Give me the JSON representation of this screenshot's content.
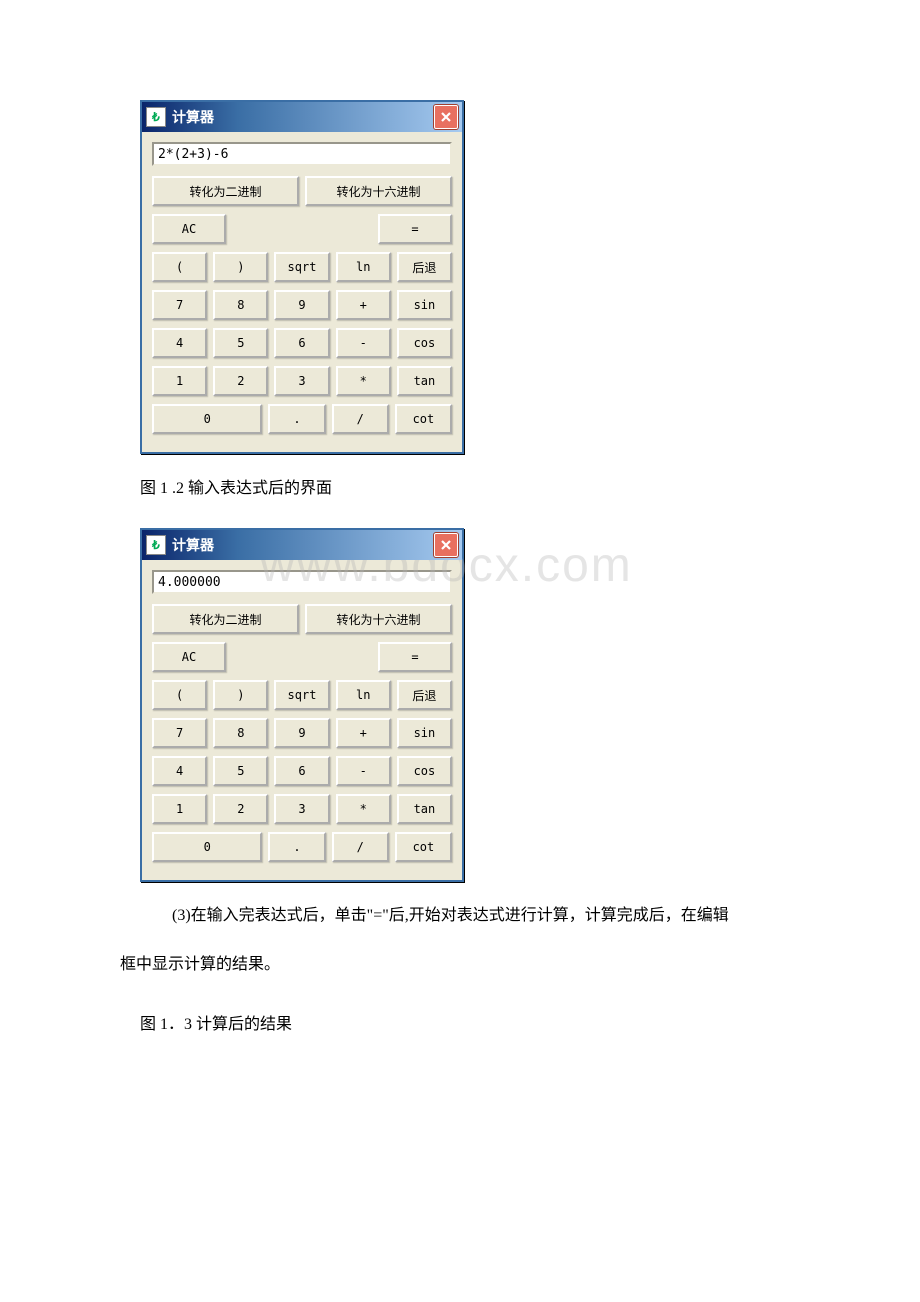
{
  "calc1": {
    "title": "计算器",
    "display_value": "2*(2+3)-6",
    "conv_bin": "转化为二进制",
    "conv_hex": "转化为十六进制",
    "ac": "AC",
    "eq": "=",
    "lp": "(",
    "rp": ")",
    "sqrt": "sqrt",
    "ln": "ln",
    "back": "后退",
    "k7": "7",
    "k8": "8",
    "k9": "9",
    "plus": "+",
    "sin": "sin",
    "k4": "4",
    "k5": "5",
    "k6": "6",
    "minus": "-",
    "cos": "cos",
    "k1": "1",
    "k2": "2",
    "k3": "3",
    "mul": "*",
    "tan": "tan",
    "k0": "0",
    "dot": ".",
    "div": "/",
    "cot": "cot"
  },
  "caption1": "图 1 .2    输入表达式后的界面",
  "calc2": {
    "title": "计算器",
    "display_value": "4.000000",
    "conv_bin": "转化为二进制",
    "conv_hex": "转化为十六进制",
    "ac": "AC",
    "eq": "=",
    "lp": "(",
    "rp": ")",
    "sqrt": "sqrt",
    "ln": "ln",
    "back": "后退",
    "k7": "7",
    "k8": "8",
    "k9": "9",
    "plus": "+",
    "sin": "sin",
    "k4": "4",
    "k5": "5",
    "k6": "6",
    "minus": "-",
    "cos": "cos",
    "k1": "1",
    "k2": "2",
    "k3": "3",
    "mul": "*",
    "tan": "tan",
    "k0": "0",
    "dot": ".",
    "div": "/",
    "cot": "cot"
  },
  "desc_part1": "(3)在输入完表达式后，单击\"=\"后,开始对表达式进行计算，计算完成后，在编辑",
  "desc_part2": "框中显示计算的结果。",
  "caption2": "图 1．3 计算后的结果",
  "watermark": "www.bdocx.com"
}
